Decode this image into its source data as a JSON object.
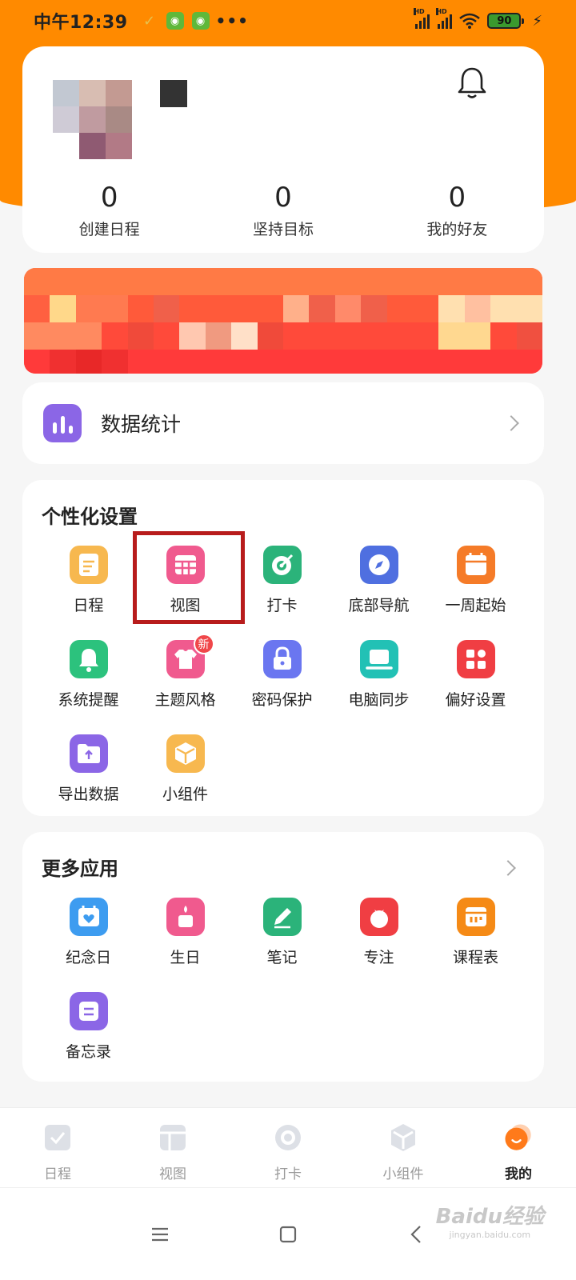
{
  "status_bar": {
    "time": "中午12:39",
    "dots": "•••",
    "battery": "90"
  },
  "profile": {
    "stats": [
      {
        "value": "0",
        "label": "创建日程"
      },
      {
        "value": "0",
        "label": "坚持目标"
      },
      {
        "value": "0",
        "label": "我的好友"
      }
    ]
  },
  "data_stats": {
    "label": "数据统计"
  },
  "personal": {
    "title": "个性化设置",
    "items": [
      {
        "label": "日程",
        "icon": "schedule-icon",
        "color": "#f7b84f"
      },
      {
        "label": "视图",
        "icon": "view-grid-icon",
        "color": "#f05a8e"
      },
      {
        "label": "打卡",
        "icon": "target-icon",
        "color": "#2bb37a"
      },
      {
        "label": "底部导航",
        "icon": "compass-icon",
        "color": "#4f6fe0"
      },
      {
        "label": "一周起始",
        "icon": "calendar-icon",
        "color": "#f57b28"
      },
      {
        "label": "系统提醒",
        "icon": "bell-icon",
        "color": "#2cc27d"
      },
      {
        "label": "主题风格",
        "icon": "shirt-icon",
        "color": "#f05a8e",
        "badge": "新"
      },
      {
        "label": "密码保护",
        "icon": "lock-icon",
        "color": "#6a76f0"
      },
      {
        "label": "电脑同步",
        "icon": "laptop-icon",
        "color": "#22c1b5"
      },
      {
        "label": "偏好设置",
        "icon": "apps-icon",
        "color": "#f03e43"
      },
      {
        "label": "导出数据",
        "icon": "export-folder-icon",
        "color": "#8b66e6"
      },
      {
        "label": "小组件",
        "icon": "widget-cube-icon",
        "color": "#f7b84f"
      }
    ]
  },
  "more": {
    "title": "更多应用",
    "items": [
      {
        "label": "纪念日",
        "icon": "anniversary-icon",
        "color": "#3d9cf0"
      },
      {
        "label": "生日",
        "icon": "birthday-cake-icon",
        "color": "#f05a8e"
      },
      {
        "label": "笔记",
        "icon": "pen-icon",
        "color": "#2bb37a"
      },
      {
        "label": "专注",
        "icon": "tomato-icon",
        "color": "#f03e43"
      },
      {
        "label": "课程表",
        "icon": "timetable-icon",
        "color": "#f58a16"
      },
      {
        "label": "备忘录",
        "icon": "memo-icon",
        "color": "#8b66e6"
      }
    ]
  },
  "bottom_nav": [
    {
      "label": "日程",
      "icon": "checkbox-icon"
    },
    {
      "label": "视图",
      "icon": "layout-icon"
    },
    {
      "label": "打卡",
      "icon": "ring-icon"
    },
    {
      "label": "小组件",
      "icon": "cube-icon"
    },
    {
      "label": "我的",
      "icon": "profile-face-icon",
      "active": true
    }
  ],
  "watermark": {
    "main": "Baidu经验",
    "sub": "jingyan.baidu.com"
  }
}
